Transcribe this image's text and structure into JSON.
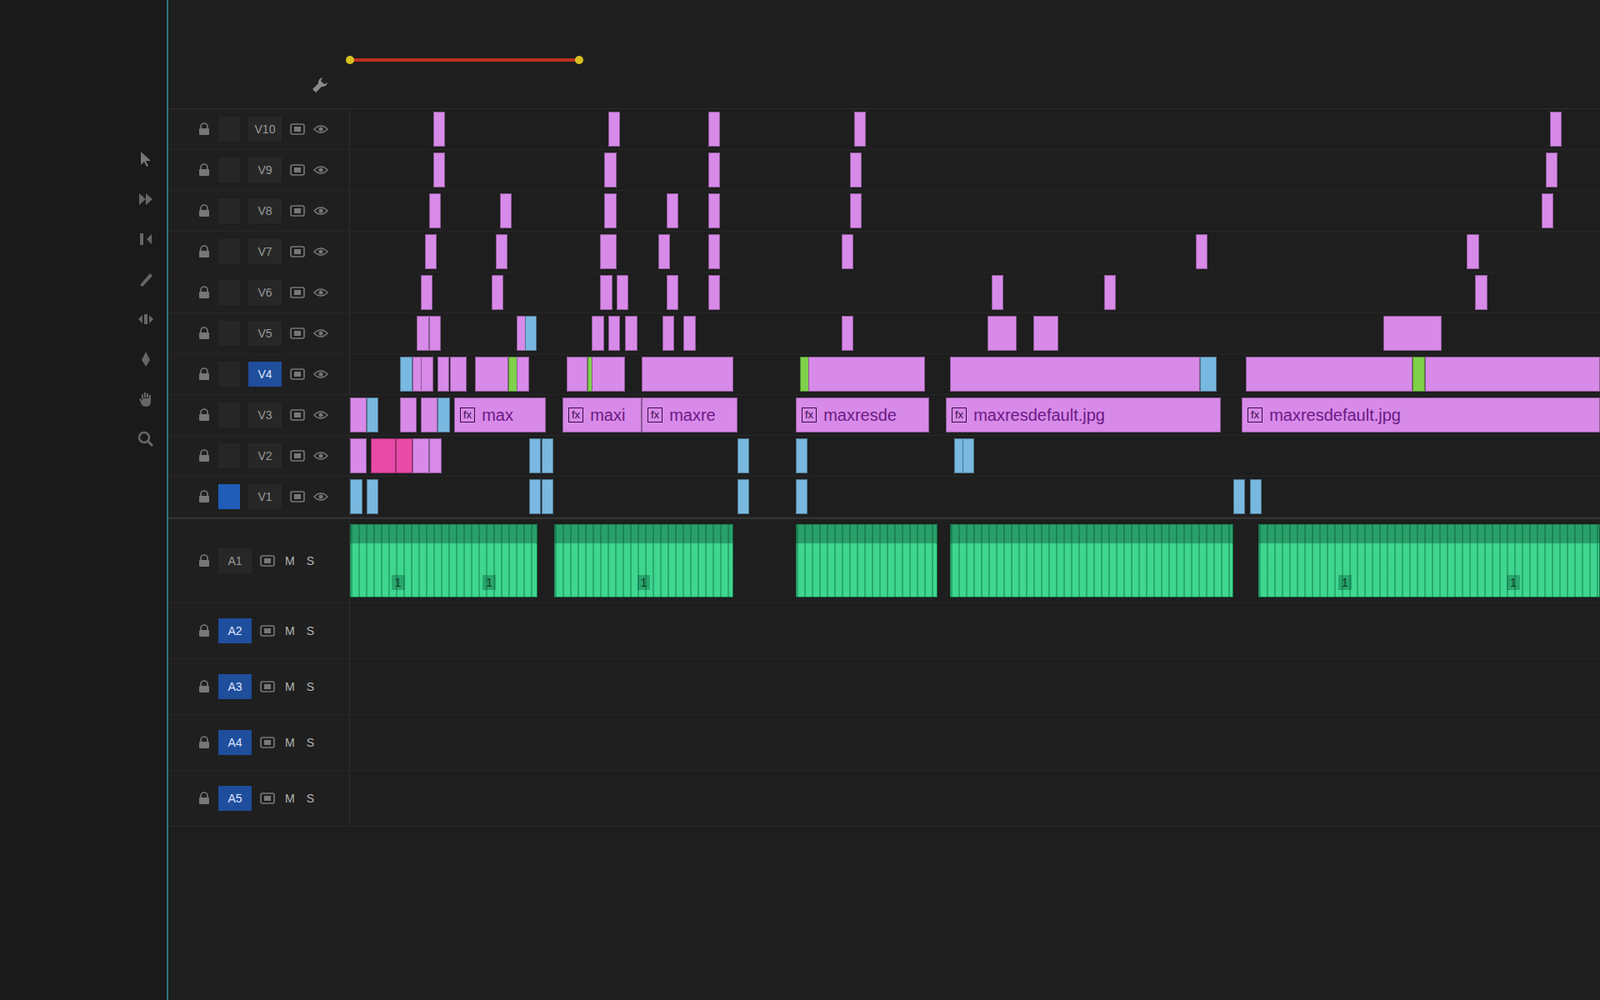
{
  "work_area": {
    "start": 0,
    "end": 55
  },
  "tracks": [
    {
      "name": "V10",
      "kind": "video",
      "targeted": false,
      "source": false,
      "clips": [
        {
          "start": 20,
          "length": 1,
          "color": "#d88ae8"
        },
        {
          "start": 62,
          "length": 2,
          "color": "#d88ae8"
        },
        {
          "start": 86,
          "length": 1,
          "color": "#d88ae8"
        },
        {
          "start": 121,
          "length": 1,
          "color": "#d88ae8"
        },
        {
          "start": 288,
          "length": 2,
          "color": "#d88ae8"
        }
      ]
    },
    {
      "name": "V9",
      "kind": "video",
      "targeted": false,
      "source": false,
      "clips": [
        {
          "start": 20,
          "length": 2,
          "color": "#d88ae8"
        },
        {
          "start": 61,
          "length": 3,
          "color": "#d88ae8"
        },
        {
          "start": 86,
          "length": 1,
          "color": "#d88ae8"
        },
        {
          "start": 120,
          "length": 1,
          "color": "#d88ae8"
        },
        {
          "start": 287,
          "length": 2,
          "color": "#d88ae8"
        }
      ]
    },
    {
      "name": "V8",
      "kind": "video",
      "targeted": false,
      "source": false,
      "clips": [
        {
          "start": 19,
          "length": 2,
          "color": "#d88ae8"
        },
        {
          "start": 36,
          "length": 1,
          "color": "#d88ae8"
        },
        {
          "start": 61,
          "length": 3,
          "color": "#d88ae8"
        },
        {
          "start": 76,
          "length": 2,
          "color": "#d88ae8"
        },
        {
          "start": 86,
          "length": 1,
          "color": "#d88ae8"
        },
        {
          "start": 120,
          "length": 1,
          "color": "#d88ae8"
        },
        {
          "start": 286,
          "length": 2,
          "color": "#d88ae8"
        }
      ]
    },
    {
      "name": "V7",
      "kind": "video",
      "targeted": false,
      "source": false,
      "clips": [
        {
          "start": 18,
          "length": 2,
          "color": "#d88ae8"
        },
        {
          "start": 35,
          "length": 2,
          "color": "#d88ae8"
        },
        {
          "start": 60,
          "length": 4,
          "color": "#d88ae8"
        },
        {
          "start": 74,
          "length": 2,
          "color": "#d88ae8"
        },
        {
          "start": 86,
          "length": 1,
          "color": "#d88ae8"
        },
        {
          "start": 118,
          "length": 1,
          "color": "#d88ae8"
        },
        {
          "start": 203,
          "length": 2,
          "color": "#d88ae8"
        },
        {
          "start": 268,
          "length": 3,
          "color": "#d88ae8"
        }
      ]
    },
    {
      "name": "V6",
      "kind": "video",
      "targeted": false,
      "source": false,
      "clips": [
        {
          "start": 17,
          "length": 2,
          "color": "#d88ae8"
        },
        {
          "start": 34,
          "length": 2,
          "color": "#d88ae8"
        },
        {
          "start": 60,
          "length": 3,
          "color": "#d88ae8"
        },
        {
          "start": 64,
          "length": 2,
          "color": "#d88ae8"
        },
        {
          "start": 76,
          "length": 2,
          "color": "#d88ae8"
        },
        {
          "start": 86,
          "length": 1,
          "color": "#d88ae8"
        },
        {
          "start": 154,
          "length": 2,
          "color": "#d88ae8"
        },
        {
          "start": 181,
          "length": 2,
          "color": "#d88ae8"
        },
        {
          "start": 270,
          "length": 3,
          "color": "#d88ae8"
        }
      ]
    },
    {
      "name": "V5",
      "kind": "video",
      "targeted": false,
      "source": false,
      "clips": [
        {
          "start": 16,
          "length": 3,
          "color": "#d88ae8"
        },
        {
          "start": 19,
          "length": 2,
          "color": "#d88ae8"
        },
        {
          "start": 40,
          "length": 2,
          "color": "#d88ae8"
        },
        {
          "start": 42,
          "length": 1,
          "color": "#79b8e0"
        },
        {
          "start": 58,
          "length": 3,
          "color": "#d88ae8"
        },
        {
          "start": 62,
          "length": 2,
          "color": "#d88ae8"
        },
        {
          "start": 66,
          "length": 3,
          "color": "#d88ae8"
        },
        {
          "start": 75,
          "length": 2,
          "color": "#d88ae8"
        },
        {
          "start": 80,
          "length": 3,
          "color": "#d88ae8"
        },
        {
          "start": 118,
          "length": 1,
          "color": "#d88ae8"
        },
        {
          "start": 153,
          "length": 7,
          "color": "#d88ae8"
        },
        {
          "start": 164,
          "length": 6,
          "color": "#d88ae8"
        },
        {
          "start": 248,
          "length": 14,
          "color": "#d88ae8"
        }
      ]
    },
    {
      "name": "V4",
      "kind": "video",
      "targeted": true,
      "source": false,
      "clips": [
        {
          "start": 12,
          "length": 3,
          "color": "#79b8e0"
        },
        {
          "start": 15,
          "length": 2,
          "color": "#d88ae8"
        },
        {
          "start": 17,
          "length": 3,
          "color": "#d88ae8"
        },
        {
          "start": 21,
          "length": 2,
          "color": "#d88ae8"
        },
        {
          "start": 24,
          "length": 4,
          "color": "#d88ae8"
        },
        {
          "start": 30,
          "length": 8,
          "color": "#d88ae8"
        },
        {
          "start": 38,
          "length": 1,
          "color": "#7fd04a"
        },
        {
          "start": 40,
          "length": 3,
          "color": "#d88ae8"
        },
        {
          "start": 52,
          "length": 5,
          "color": "#d88ae8"
        },
        {
          "start": 57,
          "length": 1,
          "color": "#7fd04a"
        },
        {
          "start": 58,
          "length": 8,
          "color": "#d88ae8"
        },
        {
          "start": 70,
          "length": 22,
          "color": "#d88ae8"
        },
        {
          "start": 108,
          "length": 2,
          "color": "#7fd04a"
        },
        {
          "start": 110,
          "length": 28,
          "color": "#d88ae8"
        },
        {
          "start": 144,
          "length": 60,
          "color": "#d88ae8"
        },
        {
          "start": 204,
          "length": 4,
          "color": "#79b8e0"
        },
        {
          "start": 215,
          "length": 40,
          "color": "#d88ae8"
        },
        {
          "start": 255,
          "length": 3,
          "color": "#7fd04a"
        },
        {
          "start": 258,
          "length": 42,
          "color": "#d88ae8"
        }
      ]
    },
    {
      "name": "V3",
      "kind": "video",
      "targeted": false,
      "source": false,
      "clips": [
        {
          "start": 0,
          "length": 4,
          "color": "#d88ae8"
        },
        {
          "start": 4,
          "length": 2,
          "color": "#79b8e0"
        },
        {
          "start": 12,
          "length": 4,
          "color": "#d88ae8"
        },
        {
          "start": 17,
          "length": 4,
          "color": "#d88ae8"
        },
        {
          "start": 21,
          "length": 3,
          "color": "#79b8e0"
        },
        {
          "start": 25,
          "length": 22,
          "color": "#d88ae8",
          "label": "max",
          "badge": "fx"
        },
        {
          "start": 51,
          "length": 19,
          "color": "#d88ae8",
          "label": "maxi",
          "badge": "fx"
        },
        {
          "start": 70,
          "length": 23,
          "color": "#d88ae8",
          "label": "maxre",
          "badge": "fx"
        },
        {
          "start": 107,
          "length": 32,
          "color": "#d88ae8",
          "label": "maxresde",
          "badge": "fx"
        },
        {
          "start": 143,
          "length": 66,
          "color": "#d88ae8",
          "label": "maxresdefault.jpg",
          "badge": "fx"
        },
        {
          "start": 214,
          "length": 86,
          "color": "#d88ae8",
          "label": "maxresdefault.jpg",
          "badge": "fx"
        }
      ]
    },
    {
      "name": "V2",
      "kind": "video",
      "targeted": false,
      "source": false,
      "clips": [
        {
          "start": 0,
          "length": 4,
          "color": "#d88ae8"
        },
        {
          "start": 5,
          "length": 6,
          "color": "#e84aa8"
        },
        {
          "start": 11,
          "length": 4,
          "color": "#e84aa8"
        },
        {
          "start": 15,
          "length": 4,
          "color": "#d88ae8"
        },
        {
          "start": 19,
          "length": 3,
          "color": "#d88ae8"
        },
        {
          "start": 43,
          "length": 1,
          "color": "#79b8e0"
        },
        {
          "start": 46,
          "length": 1,
          "color": "#79b8e0"
        },
        {
          "start": 93,
          "length": 1,
          "color": "#79b8e0"
        },
        {
          "start": 107,
          "length": 1,
          "color": "#79b8e0"
        },
        {
          "start": 145,
          "length": 1,
          "color": "#79b8e0"
        },
        {
          "start": 147,
          "length": 1,
          "color": "#79b8e0"
        }
      ]
    },
    {
      "name": "V1",
      "kind": "video",
      "targeted": false,
      "source": true,
      "clips": [
        {
          "start": 0,
          "length": 3,
          "color": "#79b8e0"
        },
        {
          "start": 4,
          "length": 1,
          "color": "#79b8e0"
        },
        {
          "start": 43,
          "length": 1,
          "color": "#79b8e0"
        },
        {
          "start": 46,
          "length": 1,
          "color": "#79b8e0"
        },
        {
          "start": 93,
          "length": 1,
          "color": "#79b8e0"
        },
        {
          "start": 107,
          "length": 1,
          "color": "#79b8e0"
        },
        {
          "start": 212,
          "length": 1,
          "color": "#79b8e0"
        },
        {
          "start": 216,
          "length": 1,
          "color": "#79b8e0"
        }
      ]
    },
    {
      "name": "A1",
      "kind": "audio",
      "targeted": false,
      "mute": "M",
      "solo": "S",
      "clips": [
        {
          "start": 0,
          "length": 45,
          "color": "#3fd690",
          "badges": [
            "1",
            "1"
          ]
        },
        {
          "start": 49,
          "length": 43,
          "color": "#3fd690",
          "badges": [
            "1"
          ]
        },
        {
          "start": 107,
          "length": 34,
          "color": "#3fd690",
          "badges": []
        },
        {
          "start": 144,
          "length": 68,
          "color": "#3fd690",
          "badges": []
        },
        {
          "start": 218,
          "length": 82,
          "color": "#3fd690",
          "badges": [
            "1",
            "1"
          ]
        }
      ]
    },
    {
      "name": "A2",
      "kind": "audio",
      "targeted": true,
      "mute": "M",
      "solo": "S",
      "clips": []
    },
    {
      "name": "A3",
      "kind": "audio",
      "targeted": true,
      "mute": "M",
      "solo": "S",
      "clips": []
    },
    {
      "name": "A4",
      "kind": "audio",
      "targeted": true,
      "mute": "M",
      "solo": "S",
      "clips": []
    },
    {
      "name": "A5",
      "kind": "audio",
      "targeted": true,
      "mute": "M",
      "solo": "S",
      "clips": []
    }
  ]
}
